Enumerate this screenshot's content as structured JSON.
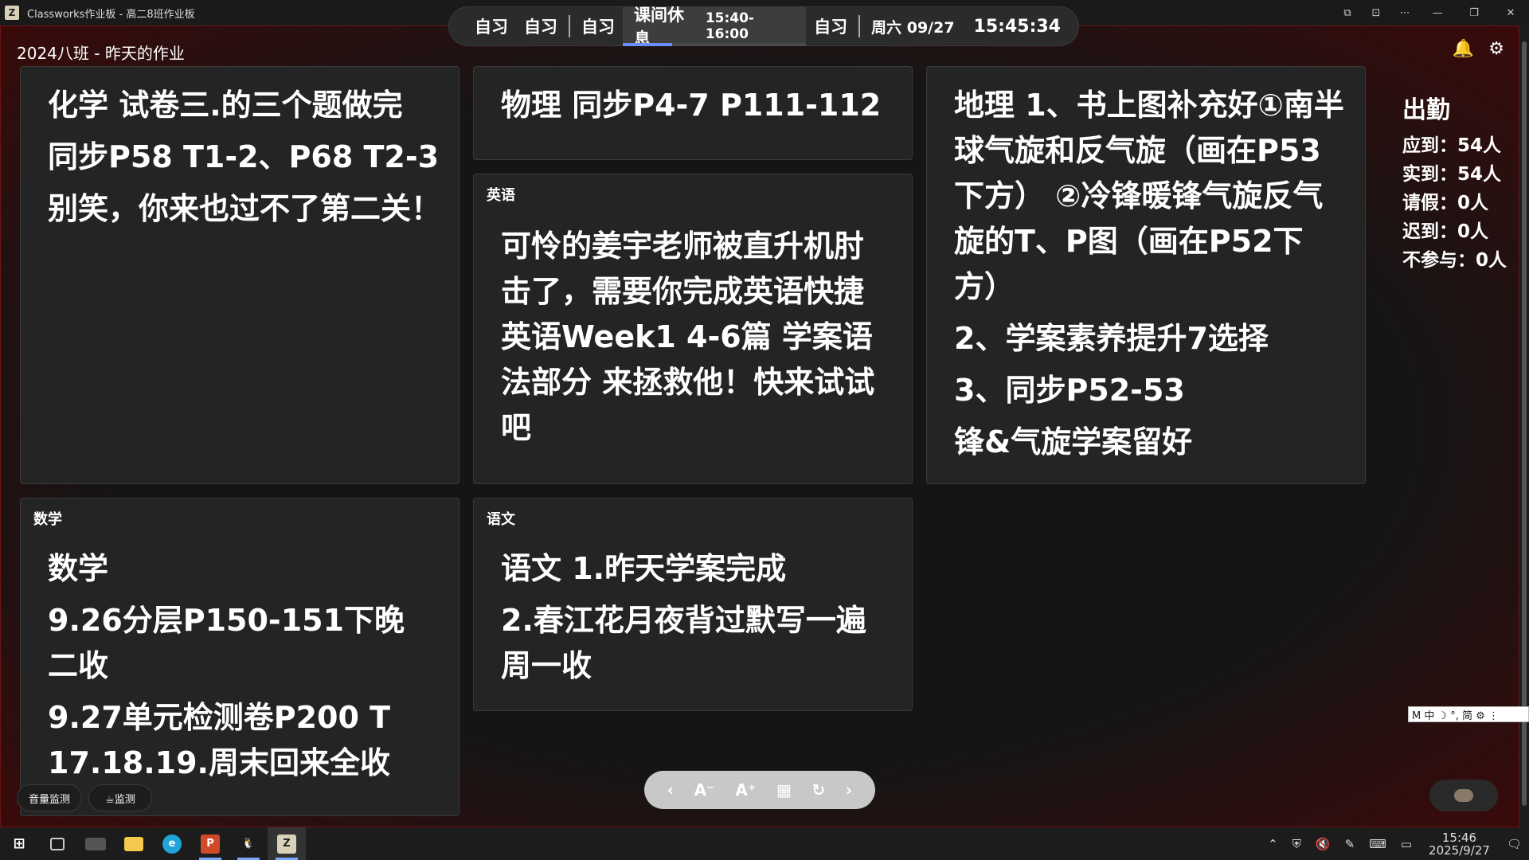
{
  "window": {
    "title": "Classworks作业板 - 高二8班作业板",
    "logo_letter": "Z",
    "controls": [
      "⧉",
      "⊡",
      "⋯",
      "—",
      "❐",
      "✕"
    ]
  },
  "schedule": {
    "items_before": [
      "自习",
      "自习"
    ],
    "item_mid": "自习",
    "current": {
      "label": "课间休息",
      "time": "15:40-16:00",
      "progress": 0.27
    },
    "item_after": "自习",
    "date": "周六 09/27",
    "clock": "15:45:34"
  },
  "header": {
    "title": "2024八班 - 昨天的作业",
    "bell_icon": "🔔",
    "gear_icon": "⚙"
  },
  "cards": {
    "chemistry": {
      "lines": [
        "化学 试卷三.的三个题做完",
        "同步P58 T1-2、P68 T2-3",
        "别笑，你来也过不了第二关！"
      ]
    },
    "physics": {
      "lines": [
        "物理 同步P4-7 P111-112"
      ]
    },
    "english": {
      "label": "英语",
      "lines": [
        "可怜的姜宇老师被直升机肘击了，需要你完成英语快捷英语Week1 4-6篇 学案语法部分 来拯救他！快来试试吧"
      ]
    },
    "geography": {
      "lines": [
        "地理 1、书上图补充好①南半球气旋和反气旋（画在P53下方） ②冷锋暖锋气旋反气旋的T、P图（画在P52下方）",
        "2、学案素养提升7选择",
        "3、同步P52-53",
        "锋&气旋学案留好"
      ]
    },
    "math": {
      "label": "数学",
      "lines": [
        "数学",
        "9.26分层P150-151下晚二收",
        "9.27单元检测卷P200 T 17.18.19.周末回来全收"
      ]
    },
    "chinese": {
      "label": "语文",
      "lines": [
        "语文 1.昨天学案完成",
        "2.春江花月夜背过默写一遍周一收"
      ]
    }
  },
  "attendance": {
    "title": "出勤",
    "expected": "应到：54人",
    "present": "实到：54人",
    "leave": "请假：0人",
    "late": "迟到：0人",
    "absent": "不参与：0人"
  },
  "toolbar": {
    "prev": "‹",
    "font_down": "A⁻",
    "font_up": "A⁺",
    "calendar": "▦",
    "refresh": "↻",
    "next": "›"
  },
  "bottom_buttons": {
    "volume": "音量监测",
    "monitor": "☕监测"
  },
  "ime": {
    "text": "M 中 ☽ °, 简 ⚙ ⋮"
  },
  "taskbar": {
    "clock_time": "15:46",
    "clock_date": "2025/9/27",
    "app_letter": "Z",
    "ppt_letter": "P",
    "qq_glyph": "🐧",
    "edge_glyph": "e"
  }
}
